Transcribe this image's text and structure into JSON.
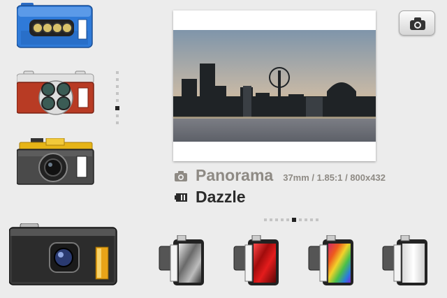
{
  "lens": {
    "name": "Panorama",
    "spec": "37mm / 1.85:1 / 800x432",
    "icon": "camera-icon"
  },
  "film": {
    "name": "Dazzle",
    "icon": "film-icon"
  },
  "shutter": {
    "icon": "camera-icon"
  },
  "camera_list": {
    "items": [
      "blue-multi-lens-camera",
      "red-four-lens-camera",
      "yellow-top-camera"
    ],
    "page_count": 8,
    "active_page": 5
  },
  "film_list": {
    "items": [
      "black-white-film",
      "red-film",
      "rainbow-film",
      "white-film"
    ],
    "page_count": 11,
    "active_page": 6
  },
  "selected_camera": "black-metal-camera",
  "colors": {
    "background": "#ececec",
    "label_gray": "#8e8a84",
    "label_dark": "#2a2a2a"
  }
}
